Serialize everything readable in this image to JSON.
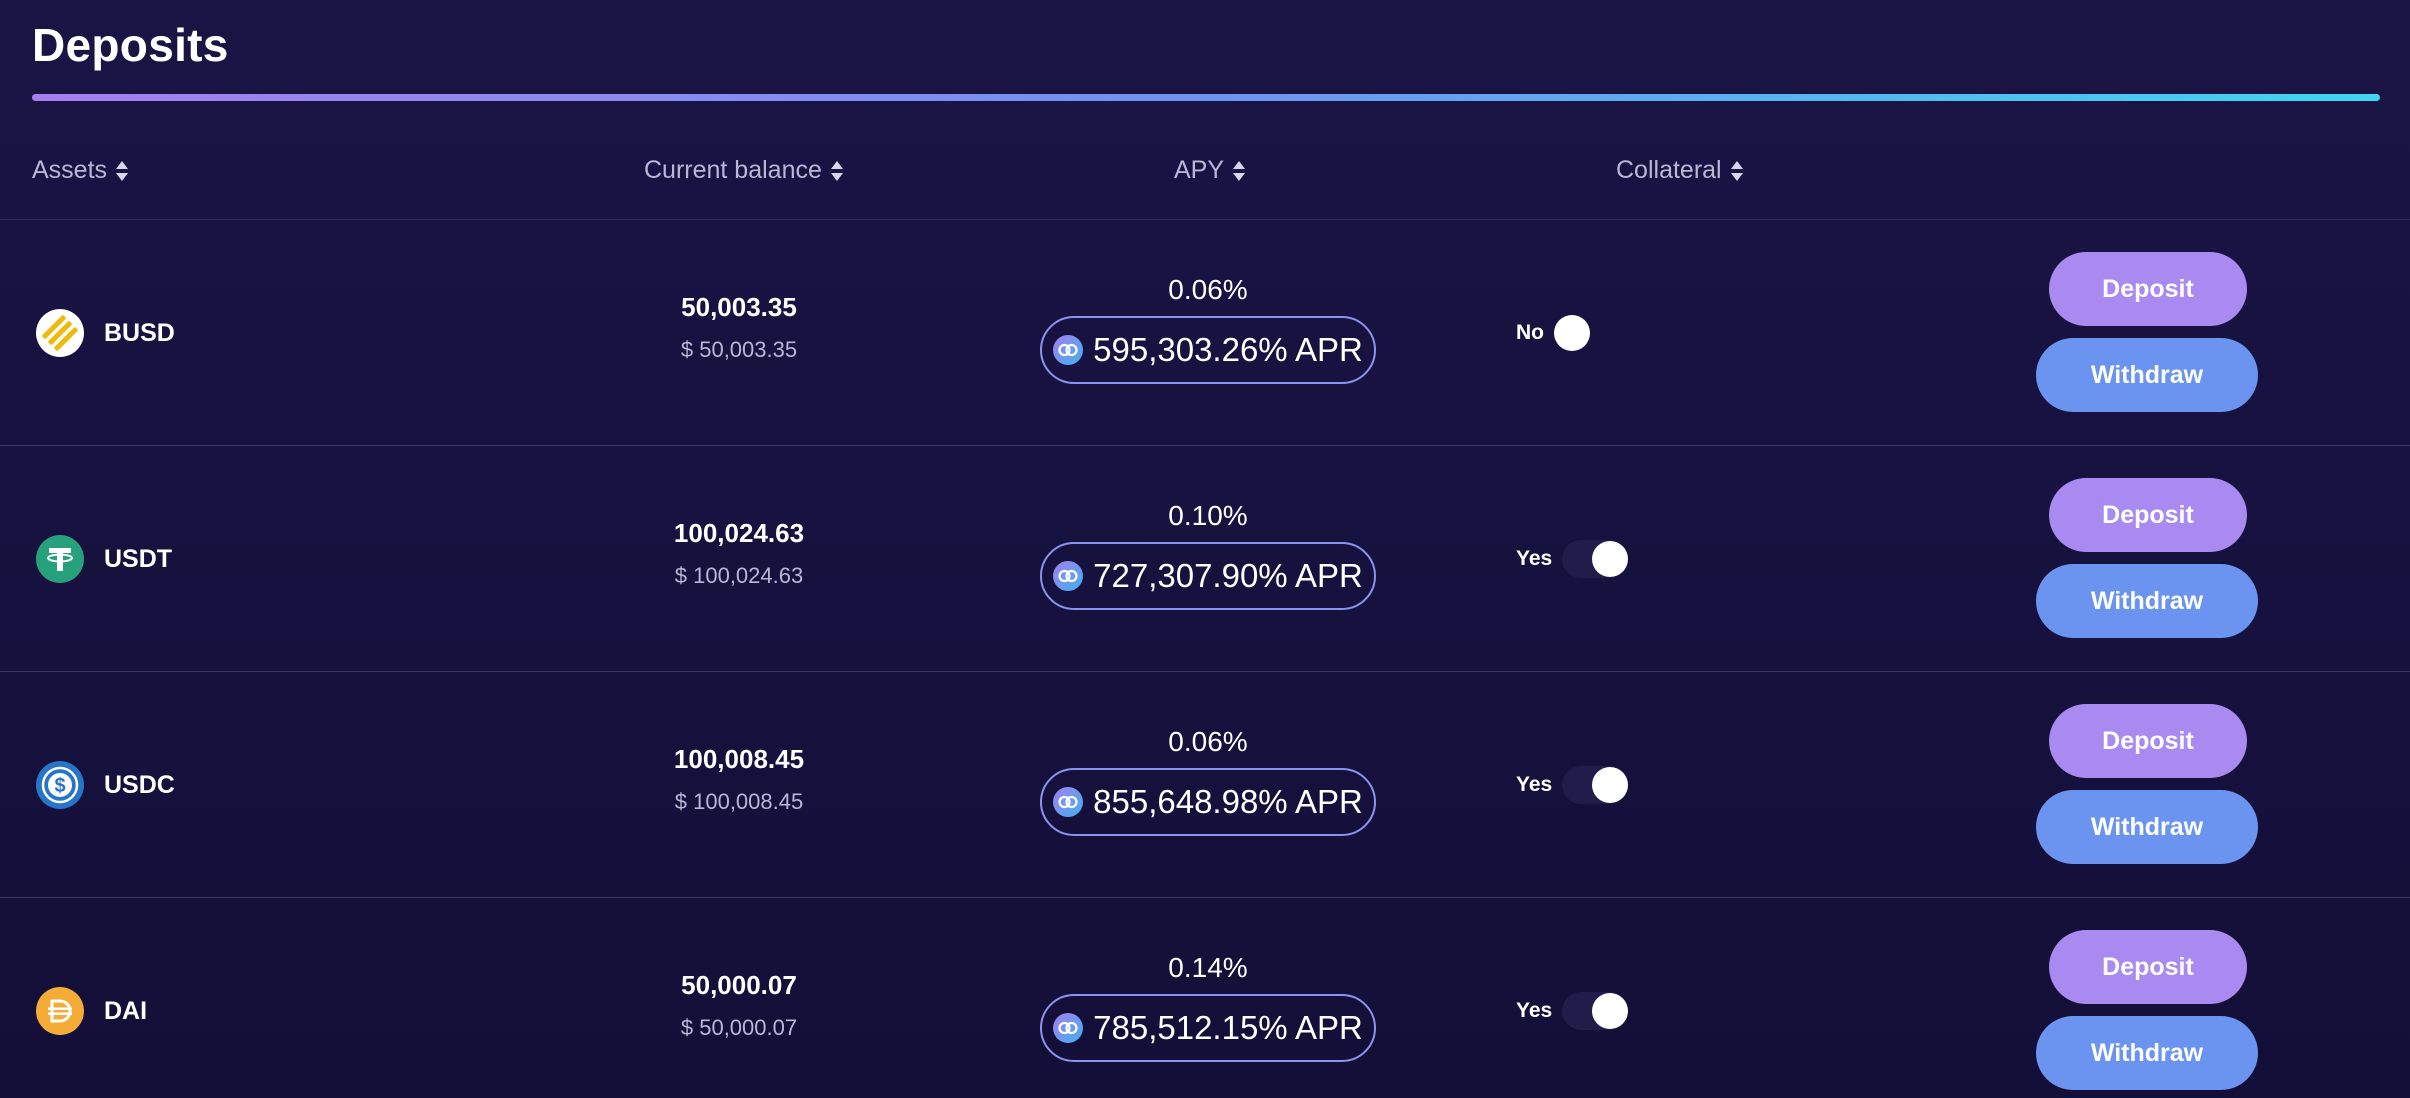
{
  "page": {
    "title": "Deposits"
  },
  "table": {
    "headers": {
      "assets": "Assets",
      "balance": "Current balance",
      "apy": "APY",
      "collateral": "Collateral"
    },
    "rows": [
      {
        "asset": "BUSD",
        "icon": "busd-token-icon",
        "icon_color": "#f0b90b",
        "balance": "50,003.35",
        "balance_usd": "$ 50,003.35",
        "apy": "0.06%",
        "apr": "595,303.26% APR",
        "collateral_label": "No",
        "collateral_on": false,
        "deposit_label": "Deposit",
        "withdraw_label": "Withdraw"
      },
      {
        "asset": "USDT",
        "icon": "usdt-token-icon",
        "icon_color": "#26a17b",
        "balance": "100,024.63",
        "balance_usd": "$ 100,024.63",
        "apy": "0.10%",
        "apr": "727,307.90% APR",
        "collateral_label": "Yes",
        "collateral_on": true,
        "deposit_label": "Deposit",
        "withdraw_label": "Withdraw"
      },
      {
        "asset": "USDC",
        "icon": "usdc-token-icon",
        "icon_color": "#2775ca",
        "balance": "100,008.45",
        "balance_usd": "$ 100,008.45",
        "apy": "0.06%",
        "apr": "855,648.98% APR",
        "collateral_label": "Yes",
        "collateral_on": true,
        "deposit_label": "Deposit",
        "withdraw_label": "Withdraw"
      },
      {
        "asset": "DAI",
        "icon": "dai-token-icon",
        "icon_color": "#f5ac37",
        "balance": "50,000.07",
        "balance_usd": "$ 50,000.07",
        "apy": "0.14%",
        "apr": "785,512.15% APR",
        "collateral_label": "Yes",
        "collateral_on": true,
        "deposit_label": "Deposit",
        "withdraw_label": "Withdraw"
      }
    ]
  },
  "colors": {
    "background": "#130e37",
    "deposit_button": "#a88af0",
    "withdraw_button": "#6b93f0",
    "accent_gradient_start": "#a57ff0",
    "accent_gradient_end": "#3fd6f0"
  }
}
